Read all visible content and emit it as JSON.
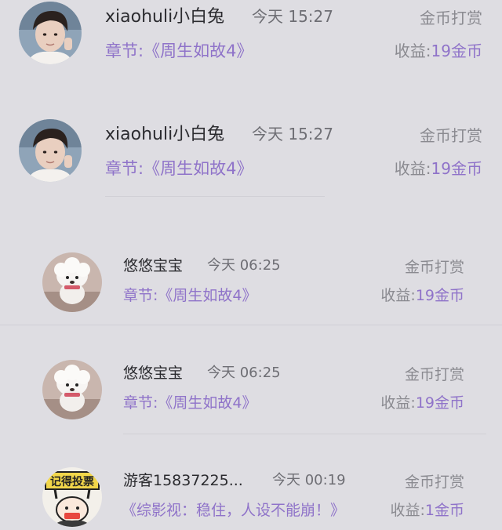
{
  "rewards": [
    {
      "avatar_icon": "boy-avatar-icon",
      "username": "xiaohuli小白兔",
      "time": "今天 15:27",
      "reward_type": "金币打赏",
      "chapter": "章节:《周生如故4》",
      "income_label": "收益:",
      "income_amount": "19金币"
    },
    {
      "avatar_icon": "boy-avatar-icon",
      "username": "xiaohuli小白兔",
      "time": "今天 15:27",
      "reward_type": "金币打赏",
      "chapter": "章节:《周生如故4》",
      "income_label": "收益:",
      "income_amount": "19金币"
    },
    {
      "avatar_icon": "white-dog-avatar-icon",
      "username": "悠悠宝宝",
      "time": "今天 06:25",
      "reward_type": "金币打赏",
      "chapter": "章节:《周生如故4》",
      "income_label": "收益:",
      "income_amount": "19金币"
    },
    {
      "avatar_icon": "white-dog-avatar-icon",
      "username": "悠悠宝宝",
      "time": "今天 06:25",
      "reward_type": "金币打赏",
      "chapter": "章节:《周生如故4》",
      "income_label": "收益:",
      "income_amount": "19金币"
    },
    {
      "avatar_icon": "cartoon-sign-avatar-icon",
      "username": "游客15837225...",
      "time": "今天 00:19",
      "reward_type": "金币打赏",
      "chapter": "《综影视：稳住，人设不能崩！》",
      "income_label": "收益:",
      "income_amount": "1金币"
    }
  ],
  "avatar_sign_text": "记得投票",
  "colors": {
    "background": "#dedde2",
    "accent_purple": "#8f73c9",
    "name_text": "#2b2b2f",
    "secondary_text": "#8a8a90"
  }
}
